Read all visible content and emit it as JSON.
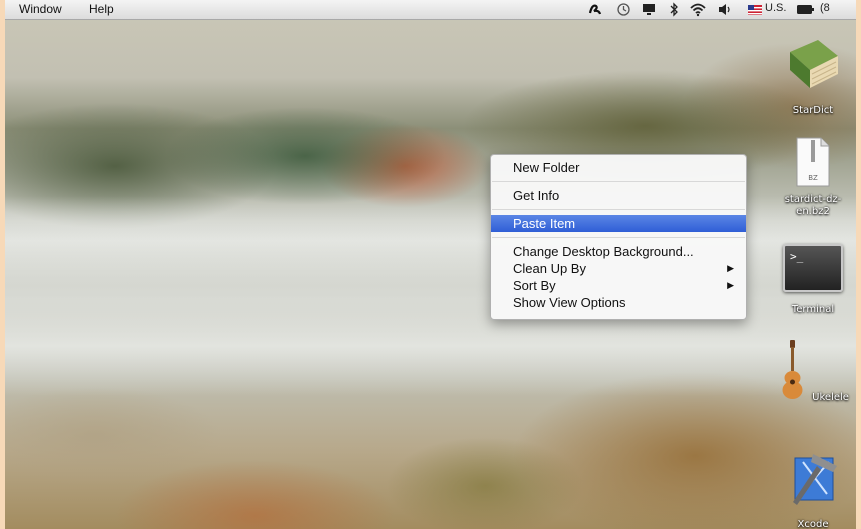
{
  "menubar": {
    "items": [
      "Window",
      "Help"
    ],
    "status": {
      "input_source": "U.S.",
      "battery_text": "(8"
    },
    "icons": [
      "script-icon",
      "time-machine-icon",
      "display-icon",
      "bluetooth-icon",
      "wifi-icon",
      "volume-icon",
      "flag-icon",
      "battery-icon"
    ]
  },
  "context_menu": {
    "items": [
      {
        "label": "New Folder"
      },
      {
        "label": "Get Info"
      },
      {
        "label": "Paste Item",
        "highlighted": true
      },
      {
        "label": "Change Desktop Background..."
      },
      {
        "label": "Clean Up By",
        "submenu": true
      },
      {
        "label": "Sort By",
        "submenu": true
      },
      {
        "label": "Show View Options"
      }
    ],
    "highlight_color": "#3a6ad9"
  },
  "desktop_icons": [
    {
      "label": "StarDict",
      "icon": "book-icon"
    },
    {
      "label": "stardict-dz-en.bz2",
      "label_line1": "stardict-dz-",
      "label_line2": "en.bz2",
      "icon": "archive-icon",
      "badge": "BZ"
    },
    {
      "label": "Terminal",
      "icon": "terminal-icon",
      "prompt": ">_"
    },
    {
      "label": "Ukelele",
      "icon": "ukulele-icon"
    },
    {
      "label": "Xcode",
      "icon": "xcode-icon"
    }
  ],
  "colors": {
    "frame": "#f7d9b8",
    "menubar": "#e6e6e6"
  }
}
